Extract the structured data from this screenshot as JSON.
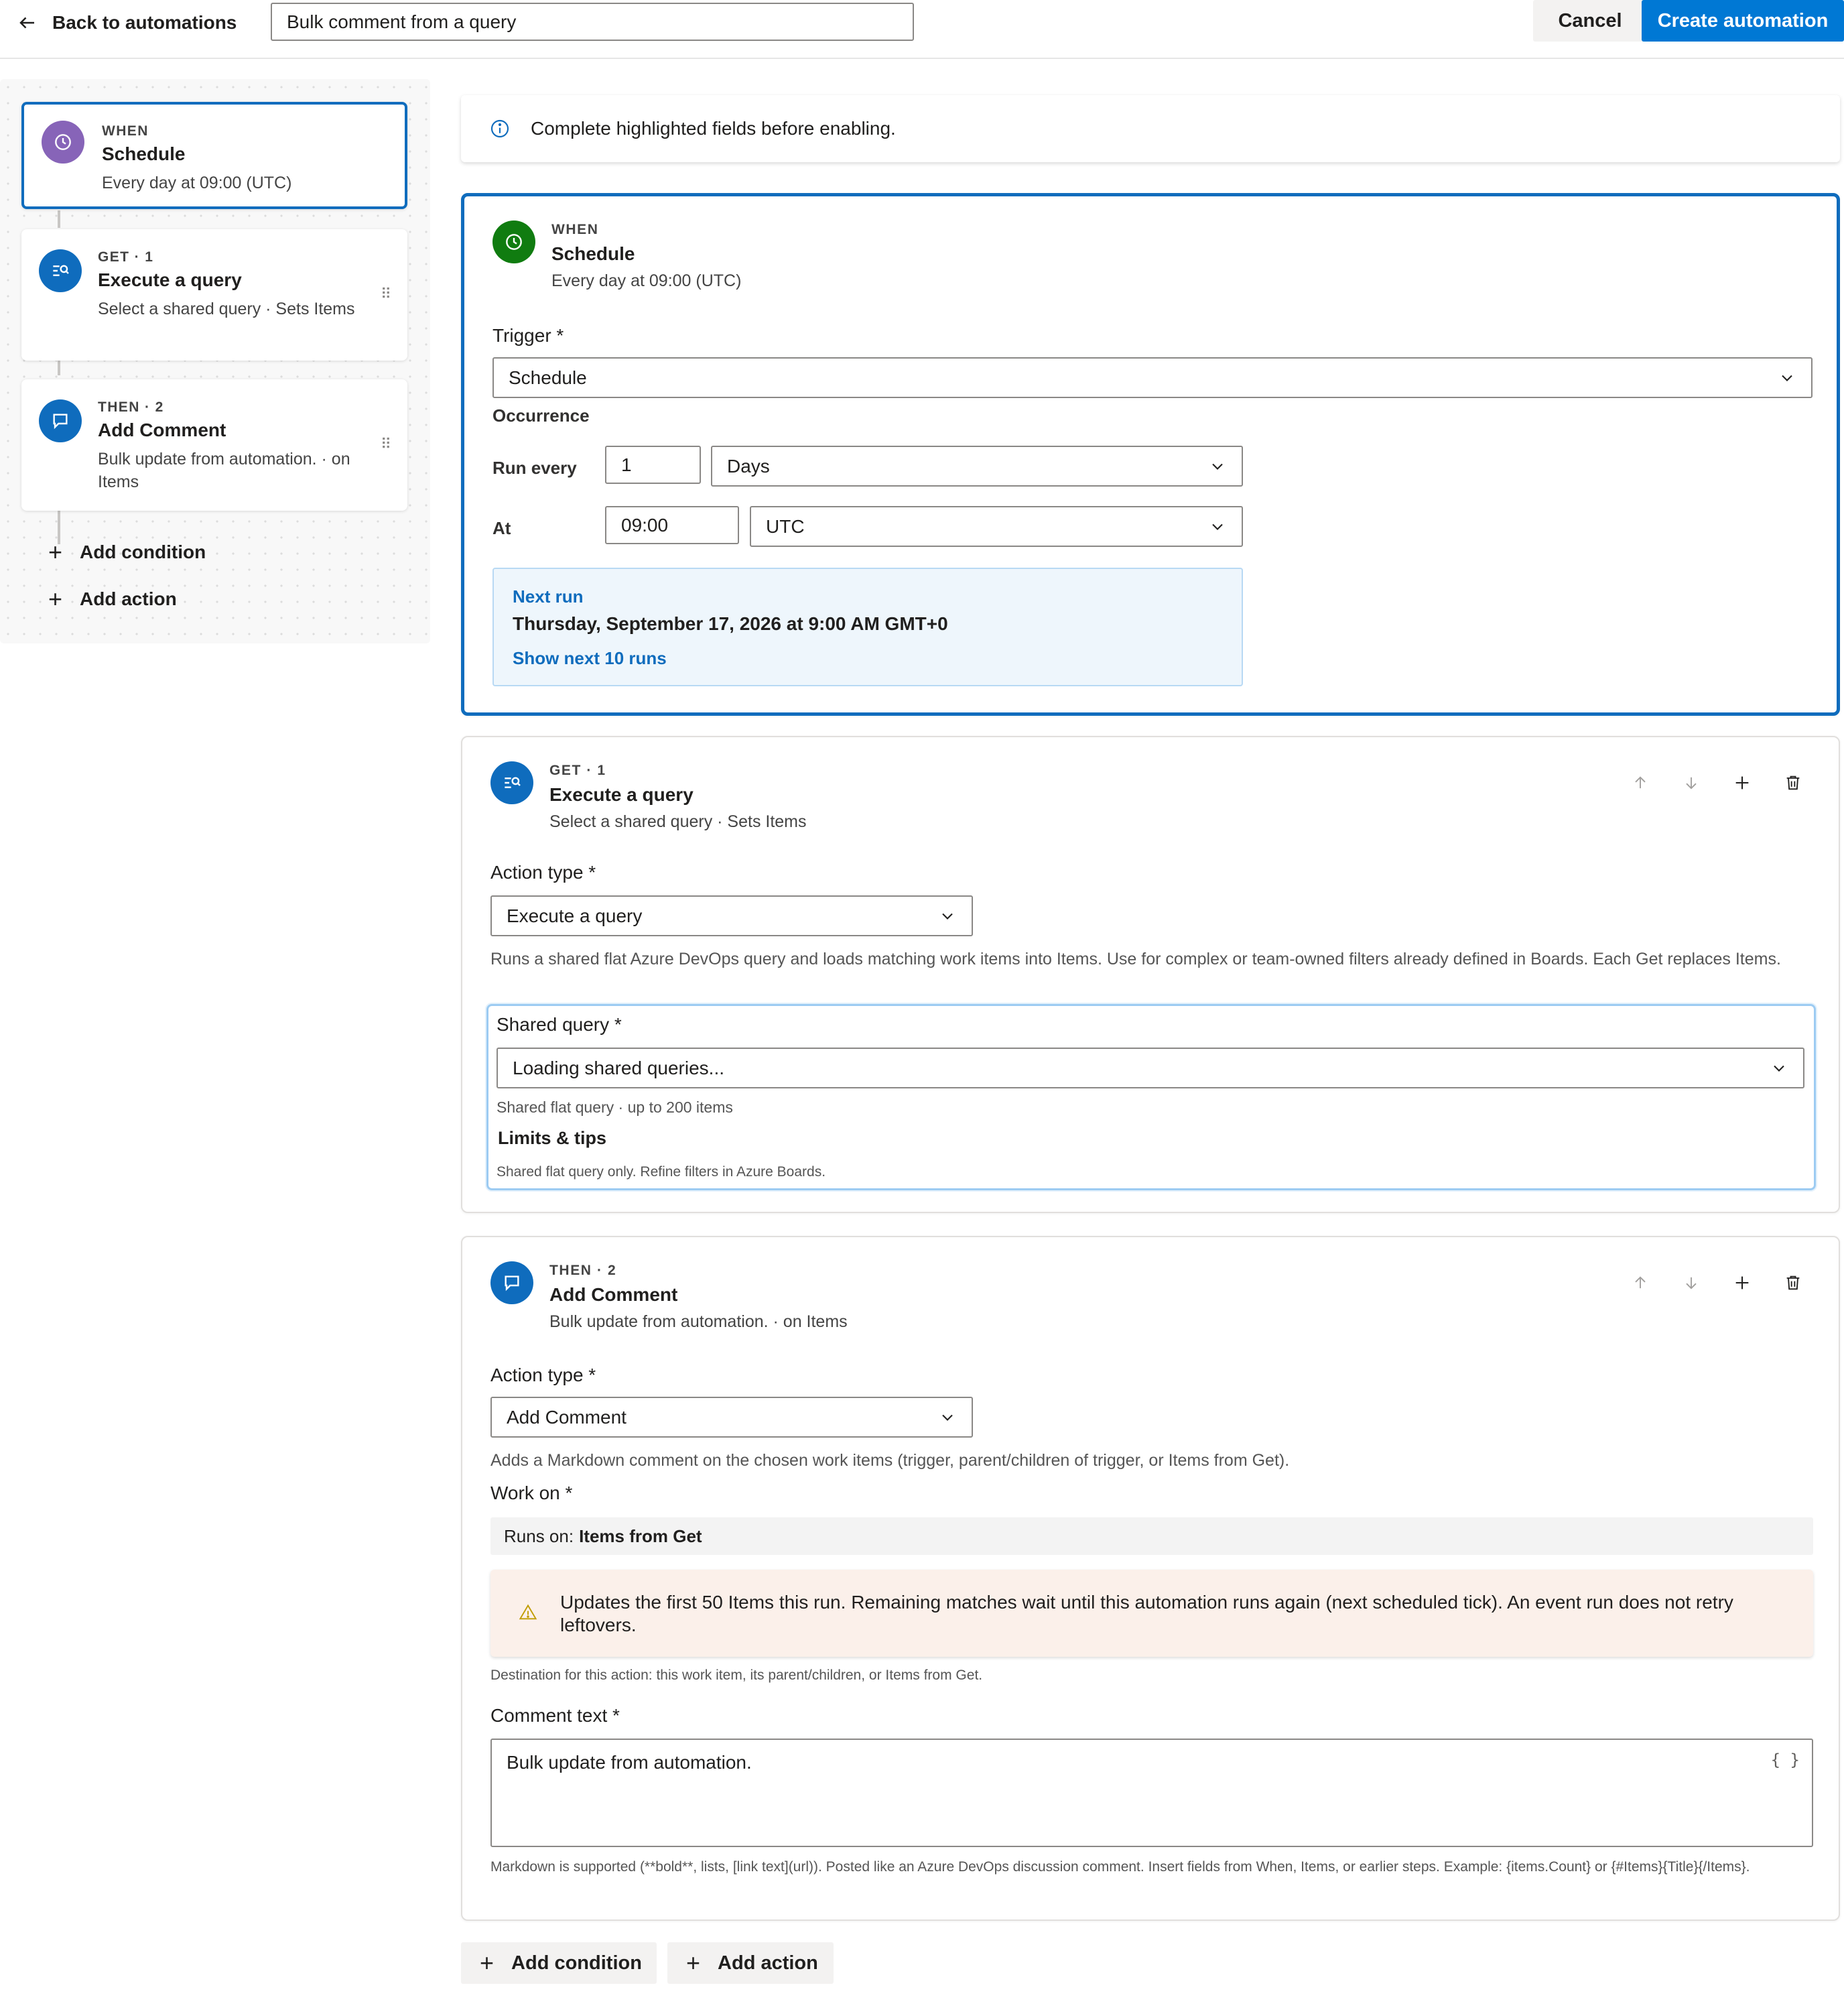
{
  "header": {
    "back_label": "Back to automations",
    "name_value": "Bulk comment from a query",
    "cancel_label": "Cancel",
    "create_label": "Create automation"
  },
  "sidebar": {
    "cards": [
      {
        "eyebrow": "WHEN",
        "title": "Schedule",
        "subtitle": "Every day at 09:00 (UTC)",
        "icon": "clock-icon",
        "color": "#8764b8"
      },
      {
        "eyebrow": "GET · 1",
        "title": "Execute a query",
        "subtitle": "Select a shared query · Sets Items",
        "icon": "query-icon",
        "color": "#0f6cbd"
      },
      {
        "eyebrow": "THEN · 2",
        "title": "Add Comment",
        "subtitle": "Bulk update from automation. · on Items",
        "icon": "comment-icon",
        "color": "#0f6cbd"
      }
    ],
    "add_condition": "Add condition",
    "add_action": "Add action"
  },
  "banner": {
    "text": "Complete highlighted fields before enabling."
  },
  "trigger_panel": {
    "eyebrow": "WHEN",
    "title": "Schedule",
    "subtitle": "Every day at 09:00 (UTC)",
    "icon_color": "#107c10",
    "trigger_label": "Trigger *",
    "trigger_value": "Schedule",
    "occurrence_label": "Occurrence",
    "run_every_label": "Run every",
    "run_every_value": "1",
    "run_every_unit": "Days",
    "at_label": "At",
    "at_value": "09:00",
    "timezone": "UTC",
    "next_run_label": "Next run",
    "next_run_date": "Thursday, September 17, 2026 at 9:00 AM GMT+0",
    "show_next_label": "Show next 10 runs"
  },
  "get_panel": {
    "eyebrow": "GET · 1",
    "title": "Execute a query",
    "subtitle": "Select a shared query · Sets Items",
    "action_type_label": "Action type *",
    "action_type_value": "Execute a query",
    "description": "Runs a shared flat Azure DevOps query and loads matching work items into Items. Use for complex or team-owned filters already defined in Boards. Each Get replaces Items.",
    "shared_query_label": "Shared query *",
    "shared_query_value": "Loading shared queries...",
    "shared_query_help": "Shared flat query · up to 200 items",
    "limits_title": "Limits & tips",
    "limits_text": "Shared flat query only. Refine filters in Azure Boards."
  },
  "then_panel": {
    "eyebrow": "THEN · 2",
    "title": "Add Comment",
    "subtitle": "Bulk update from automation. · on Items",
    "action_type_label": "Action type *",
    "action_type_value": "Add Comment",
    "description": "Adds a Markdown comment on the chosen work items (trigger, parent/children of trigger, or Items from Get).",
    "work_on_label": "Work on *",
    "runs_on_prefix": "Runs on:",
    "runs_on_value": "Items from Get",
    "warning": "Updates the first 50 Items this run. Remaining matches wait until this automation runs again (next scheduled tick). An event run does not retry leftovers.",
    "destination_help": "Destination for this action: this work item, its parent/children, or Items from Get.",
    "comment_label": "Comment text *",
    "comment_value": "Bulk update from automation.",
    "insert_icon": "{ }",
    "markdown_help": "Markdown is supported (**bold**, lists, [link text](url)). Posted like an Azure DevOps discussion comment. Insert fields from When, Items, or earlier steps. Example: {items.Count} or {#Items}{Title}{/Items}."
  },
  "footer": {
    "add_condition": "Add condition",
    "add_action": "Add action"
  }
}
